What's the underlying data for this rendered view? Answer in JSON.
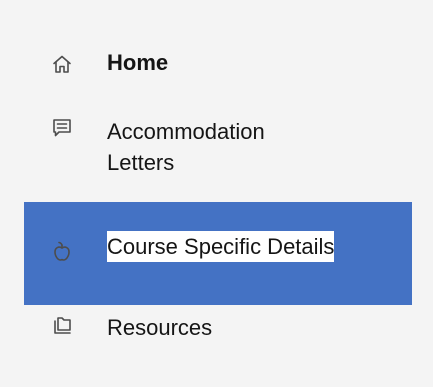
{
  "nav": {
    "items": [
      {
        "label": "Home",
        "icon": "home-icon",
        "active": false
      },
      {
        "label": "Accommodation Letters",
        "icon": "letter-icon",
        "active": false
      },
      {
        "label": "Course Specific Details",
        "icon": "apple-icon",
        "active": true
      },
      {
        "label": "Resources",
        "icon": "folder-icon",
        "active": false
      }
    ]
  },
  "colors": {
    "sidebar_background": "#f4f4f4",
    "active_background": "#4472c4",
    "active_text": "#151515",
    "text": "#151515",
    "icon": "#4d4d4d"
  }
}
